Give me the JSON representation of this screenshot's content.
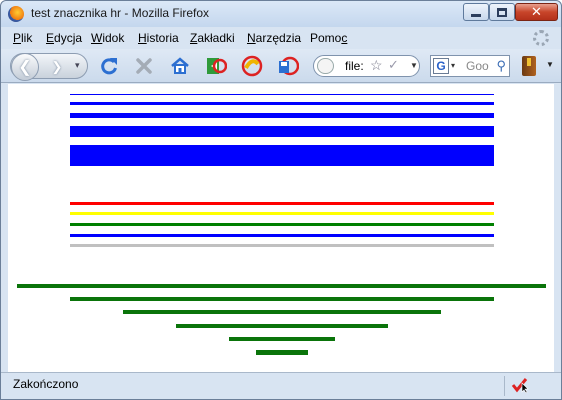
{
  "window": {
    "title": "test znacznika hr - Mozilla Firefox"
  },
  "menu": [
    {
      "label": "Plik",
      "access": "P"
    },
    {
      "label": "Edycja",
      "access": "E"
    },
    {
      "label": "Widok",
      "access": "W"
    },
    {
      "label": "Historia",
      "access": "H"
    },
    {
      "label": "Zakładki",
      "access": "Z"
    },
    {
      "label": "Narzędzia",
      "access": "N"
    },
    {
      "label": "Pomoc",
      "access": "c"
    }
  ],
  "toolbar": {
    "url_value": "file:",
    "search_placeholder": "Goo",
    "search_engine_letter": "G"
  },
  "content": {
    "blue_rules": {
      "color": "#0000ff",
      "count": 5
    },
    "colored_rules": {
      "colors": [
        "#ff0000",
        "#ffff00",
        "#008000",
        "#0000ff",
        "#c0c0c0"
      ]
    },
    "green_rules": {
      "color": "#008000",
      "count": 6
    }
  },
  "status": {
    "text": "Zakończono"
  },
  "colors": {
    "chrome": "#d8e4f2",
    "close_button": "#c8452a"
  },
  "icons": [
    "back-arrow-icon",
    "forward-arrow-icon",
    "reload-icon",
    "stop-icon",
    "home-icon",
    "addon-icon",
    "bookmark-icon",
    "save-icon",
    "star-icon",
    "search-icon",
    "book-icon"
  ]
}
